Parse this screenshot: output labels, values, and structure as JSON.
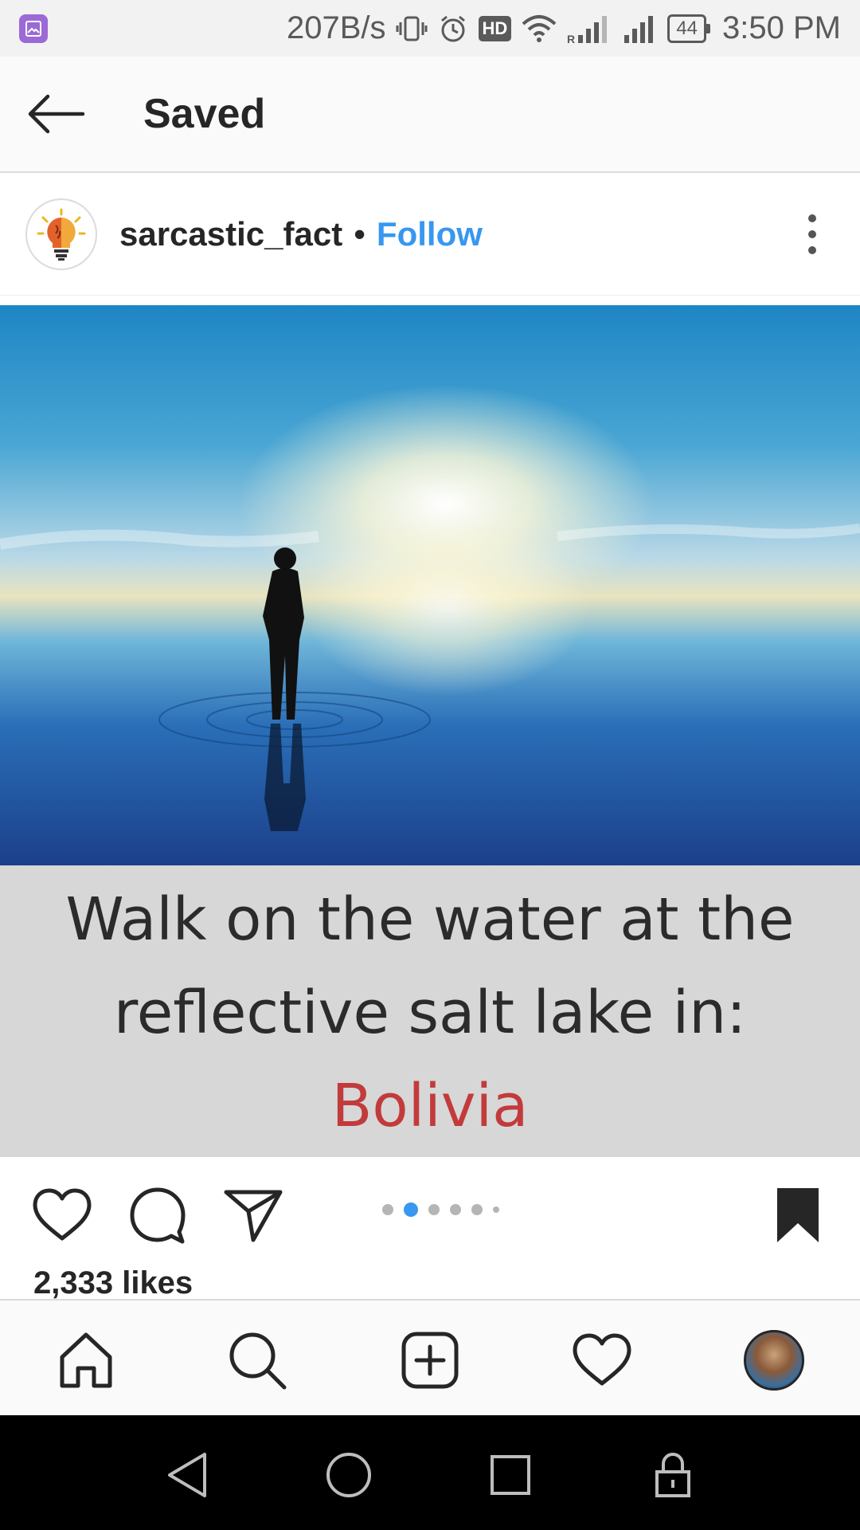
{
  "status_bar": {
    "network_speed": "207B/s",
    "hd_label": "HD",
    "battery_level": "44",
    "time": "3:50 PM",
    "icons": [
      "gallery-icon",
      "vibrate-icon",
      "alarm-icon",
      "hd-icon",
      "wifi-icon",
      "signal-icon",
      "signal-icon",
      "battery-icon"
    ]
  },
  "header": {
    "title": "Saved",
    "back_icon": "arrow-left-icon"
  },
  "post": {
    "username": "sarcastic_fact",
    "separator": "•",
    "follow_label": "Follow",
    "follow_color": "#3897f0",
    "more_icon": "more-vertical-icon",
    "image_caption": {
      "line1": "Walk on the water at the",
      "line2": "reflective salt lake in:",
      "country": "Bolivia",
      "country_color": "#c23b3b"
    },
    "carousel": {
      "count": 6,
      "active_index": 1
    },
    "likes": "2,333 likes",
    "saved": true
  },
  "bottom_nav": {
    "items": [
      "home-icon",
      "search-icon",
      "add-post-icon",
      "activity-heart-icon",
      "profile-avatar"
    ]
  },
  "android_nav": {
    "items": [
      "back-triangle-icon",
      "home-circle-icon",
      "recents-square-icon",
      "lock-icon"
    ]
  }
}
